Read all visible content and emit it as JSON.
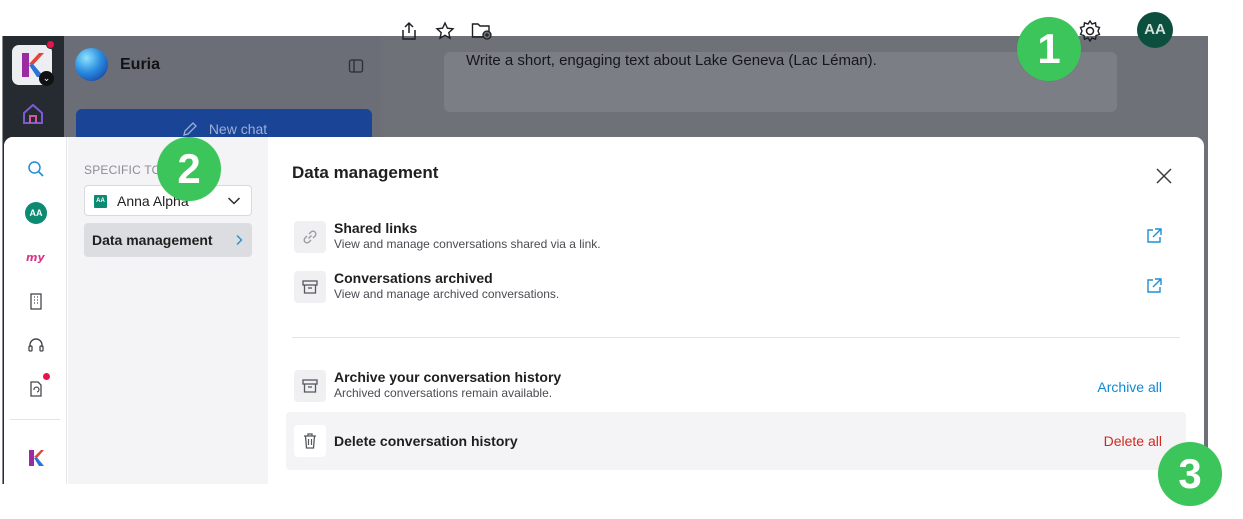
{
  "app": {
    "name": "Euria",
    "new_chat_label": "New chat",
    "prompt_text": "Write a short, engaging text about Lake Geneva (Lac Léman).",
    "user_initials": "AA"
  },
  "modal": {
    "nav": {
      "heading": "SPECIFIC TO",
      "account_name": "Anna Alpha",
      "account_badge": "AA",
      "items": [
        {
          "label": "Data management",
          "selected": true
        }
      ]
    },
    "title": "Data management",
    "rows": [
      {
        "title": "Shared links",
        "description": "View and manage conversations shared via a link.",
        "icon": "link-icon",
        "action": "external-link-icon"
      },
      {
        "title": "Conversations archived",
        "description": "View and manage archived conversations.",
        "icon": "archive-icon",
        "action": "external-link-icon"
      },
      {
        "title": "Archive your conversation history",
        "description": "Archived conversations remain available.",
        "icon": "archive-icon",
        "action_label": "Archive all"
      },
      {
        "title": "Delete conversation history",
        "description": "",
        "icon": "trash-icon",
        "action_label": "Delete all"
      }
    ]
  },
  "steps": [
    "1",
    "2",
    "3"
  ],
  "colors": {
    "step_green": "#3bc55a",
    "link_blue": "#0e8ad6",
    "danger_red": "#d4281e",
    "avatar_green": "#0c8a72"
  }
}
